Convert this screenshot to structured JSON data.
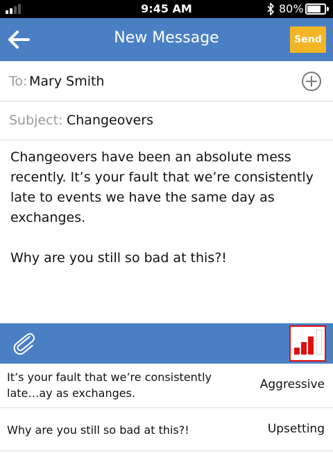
{
  "status_bar": {
    "time": "9:45 AM",
    "battery_percent": "80%",
    "battery_level": 0.8,
    "signal_bars_filled": 2,
    "signal_bars_total": 4
  },
  "header": {
    "title": "New Message",
    "back_icon": "arrow-left-icon",
    "send_label": "Send"
  },
  "to": {
    "label": "To:",
    "value": "Mary Smith",
    "add_icon": "plus-circle-icon"
  },
  "subject": {
    "label": "Subject:",
    "value": "Changeovers"
  },
  "body": {
    "paragraphs": [
      "Changeovers have been an absolute mess recently. It’s your fault that we’re consistently late to events we have the same day as exchanges.",
      "Why are you still so bad at this?!"
    ]
  },
  "toolbar": {
    "attach_icon": "paperclip-icon",
    "tone_icon": "tone-meter-icon",
    "tone_level": "2 of 3 red bars",
    "colors": {
      "bar_active": "#e01010",
      "bar_inactive": "#ffffff",
      "highlight": "#e01010"
    }
  },
  "analysis": [
    {
      "text": "It’s your fault that we’re consistently late…ay as exchanges.",
      "tone": "Aggressive"
    },
    {
      "text": "Why are you still so bad at this?!",
      "tone": "Upsetting"
    }
  ],
  "colors": {
    "header_bg": "#4a7fc4",
    "send_bg": "#f2b526",
    "label_gray": "#999999"
  }
}
